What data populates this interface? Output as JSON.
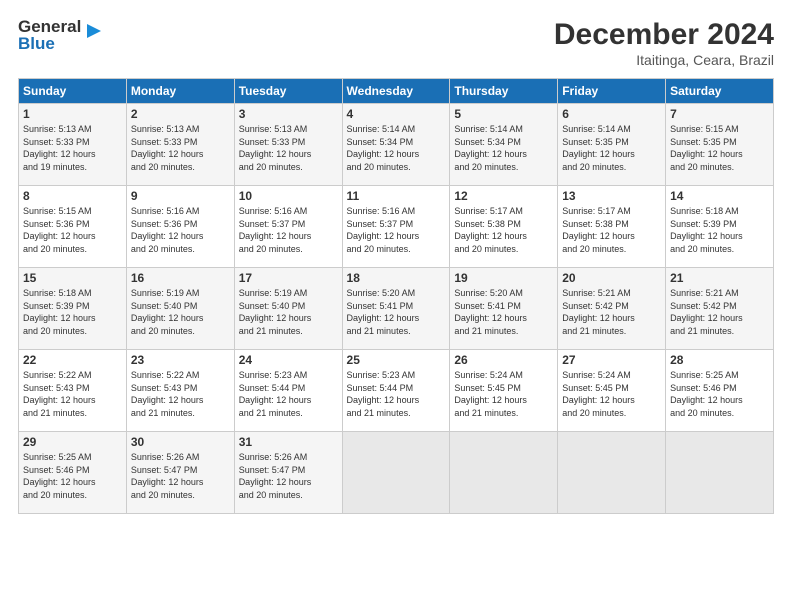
{
  "header": {
    "logo_line1": "General",
    "logo_line2": "Blue",
    "title": "December 2024",
    "subtitle": "Itaitinga, Ceara, Brazil"
  },
  "columns": [
    "Sunday",
    "Monday",
    "Tuesday",
    "Wednesday",
    "Thursday",
    "Friday",
    "Saturday"
  ],
  "weeks": [
    [
      {
        "day": "1",
        "lines": [
          "Sunrise: 5:13 AM",
          "Sunset: 5:33 PM",
          "Daylight: 12 hours",
          "and 19 minutes."
        ]
      },
      {
        "day": "2",
        "lines": [
          "Sunrise: 5:13 AM",
          "Sunset: 5:33 PM",
          "Daylight: 12 hours",
          "and 20 minutes."
        ]
      },
      {
        "day": "3",
        "lines": [
          "Sunrise: 5:13 AM",
          "Sunset: 5:33 PM",
          "Daylight: 12 hours",
          "and 20 minutes."
        ]
      },
      {
        "day": "4",
        "lines": [
          "Sunrise: 5:14 AM",
          "Sunset: 5:34 PM",
          "Daylight: 12 hours",
          "and 20 minutes."
        ]
      },
      {
        "day": "5",
        "lines": [
          "Sunrise: 5:14 AM",
          "Sunset: 5:34 PM",
          "Daylight: 12 hours",
          "and 20 minutes."
        ]
      },
      {
        "day": "6",
        "lines": [
          "Sunrise: 5:14 AM",
          "Sunset: 5:35 PM",
          "Daylight: 12 hours",
          "and 20 minutes."
        ]
      },
      {
        "day": "7",
        "lines": [
          "Sunrise: 5:15 AM",
          "Sunset: 5:35 PM",
          "Daylight: 12 hours",
          "and 20 minutes."
        ]
      }
    ],
    [
      {
        "day": "8",
        "lines": [
          "Sunrise: 5:15 AM",
          "Sunset: 5:36 PM",
          "Daylight: 12 hours",
          "and 20 minutes."
        ]
      },
      {
        "day": "9",
        "lines": [
          "Sunrise: 5:16 AM",
          "Sunset: 5:36 PM",
          "Daylight: 12 hours",
          "and 20 minutes."
        ]
      },
      {
        "day": "10",
        "lines": [
          "Sunrise: 5:16 AM",
          "Sunset: 5:37 PM",
          "Daylight: 12 hours",
          "and 20 minutes."
        ]
      },
      {
        "day": "11",
        "lines": [
          "Sunrise: 5:16 AM",
          "Sunset: 5:37 PM",
          "Daylight: 12 hours",
          "and 20 minutes."
        ]
      },
      {
        "day": "12",
        "lines": [
          "Sunrise: 5:17 AM",
          "Sunset: 5:38 PM",
          "Daylight: 12 hours",
          "and 20 minutes."
        ]
      },
      {
        "day": "13",
        "lines": [
          "Sunrise: 5:17 AM",
          "Sunset: 5:38 PM",
          "Daylight: 12 hours",
          "and 20 minutes."
        ]
      },
      {
        "day": "14",
        "lines": [
          "Sunrise: 5:18 AM",
          "Sunset: 5:39 PM",
          "Daylight: 12 hours",
          "and 20 minutes."
        ]
      }
    ],
    [
      {
        "day": "15",
        "lines": [
          "Sunrise: 5:18 AM",
          "Sunset: 5:39 PM",
          "Daylight: 12 hours",
          "and 20 minutes."
        ]
      },
      {
        "day": "16",
        "lines": [
          "Sunrise: 5:19 AM",
          "Sunset: 5:40 PM",
          "Daylight: 12 hours",
          "and 20 minutes."
        ]
      },
      {
        "day": "17",
        "lines": [
          "Sunrise: 5:19 AM",
          "Sunset: 5:40 PM",
          "Daylight: 12 hours",
          "and 21 minutes."
        ]
      },
      {
        "day": "18",
        "lines": [
          "Sunrise: 5:20 AM",
          "Sunset: 5:41 PM",
          "Daylight: 12 hours",
          "and 21 minutes."
        ]
      },
      {
        "day": "19",
        "lines": [
          "Sunrise: 5:20 AM",
          "Sunset: 5:41 PM",
          "Daylight: 12 hours",
          "and 21 minutes."
        ]
      },
      {
        "day": "20",
        "lines": [
          "Sunrise: 5:21 AM",
          "Sunset: 5:42 PM",
          "Daylight: 12 hours",
          "and 21 minutes."
        ]
      },
      {
        "day": "21",
        "lines": [
          "Sunrise: 5:21 AM",
          "Sunset: 5:42 PM",
          "Daylight: 12 hours",
          "and 21 minutes."
        ]
      }
    ],
    [
      {
        "day": "22",
        "lines": [
          "Sunrise: 5:22 AM",
          "Sunset: 5:43 PM",
          "Daylight: 12 hours",
          "and 21 minutes."
        ]
      },
      {
        "day": "23",
        "lines": [
          "Sunrise: 5:22 AM",
          "Sunset: 5:43 PM",
          "Daylight: 12 hours",
          "and 21 minutes."
        ]
      },
      {
        "day": "24",
        "lines": [
          "Sunrise: 5:23 AM",
          "Sunset: 5:44 PM",
          "Daylight: 12 hours",
          "and 21 minutes."
        ]
      },
      {
        "day": "25",
        "lines": [
          "Sunrise: 5:23 AM",
          "Sunset: 5:44 PM",
          "Daylight: 12 hours",
          "and 21 minutes."
        ]
      },
      {
        "day": "26",
        "lines": [
          "Sunrise: 5:24 AM",
          "Sunset: 5:45 PM",
          "Daylight: 12 hours",
          "and 21 minutes."
        ]
      },
      {
        "day": "27",
        "lines": [
          "Sunrise: 5:24 AM",
          "Sunset: 5:45 PM",
          "Daylight: 12 hours",
          "and 20 minutes."
        ]
      },
      {
        "day": "28",
        "lines": [
          "Sunrise: 5:25 AM",
          "Sunset: 5:46 PM",
          "Daylight: 12 hours",
          "and 20 minutes."
        ]
      }
    ],
    [
      {
        "day": "29",
        "lines": [
          "Sunrise: 5:25 AM",
          "Sunset: 5:46 PM",
          "Daylight: 12 hours",
          "and 20 minutes."
        ]
      },
      {
        "day": "30",
        "lines": [
          "Sunrise: 5:26 AM",
          "Sunset: 5:47 PM",
          "Daylight: 12 hours",
          "and 20 minutes."
        ]
      },
      {
        "day": "31",
        "lines": [
          "Sunrise: 5:26 AM",
          "Sunset: 5:47 PM",
          "Daylight: 12 hours",
          "and 20 minutes."
        ]
      },
      {
        "day": "",
        "lines": []
      },
      {
        "day": "",
        "lines": []
      },
      {
        "day": "",
        "lines": []
      },
      {
        "day": "",
        "lines": []
      }
    ]
  ]
}
